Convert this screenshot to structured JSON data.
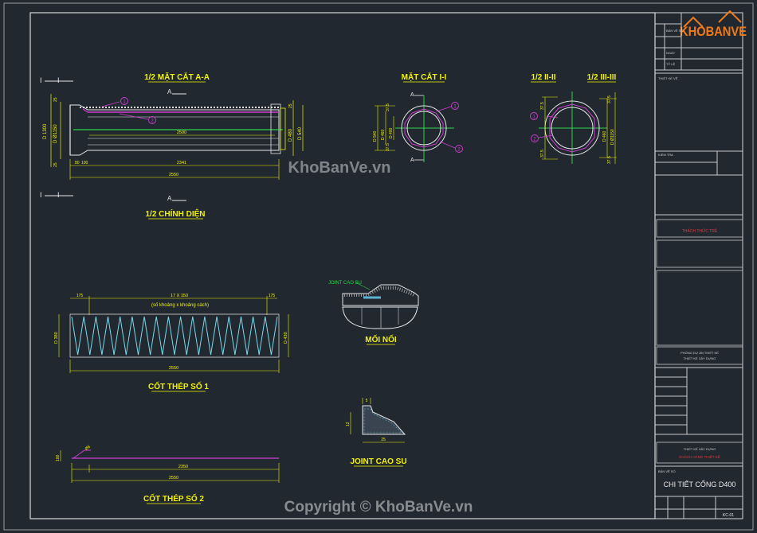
{
  "drawing": {
    "views": {
      "section_aa_title": "1/2 MẶT CẮT A-A",
      "front_view_title": "1/2 CHÍNH DIỆN",
      "section_ii_title": "MẶT CẮT I-I",
      "half_ii_title": "1/2 II-II",
      "half_iii_title": "1/2 III-III",
      "joint_title": "MỐI NỐI",
      "rebar1_title": "CỐT THÉP SỐ 1",
      "rebar2_title": "CỐT THÉP SỐ 2",
      "rubber_joint_title": "JOINT CAO SU"
    },
    "section_markers": {
      "I": "I",
      "A": "A",
      "II": "II",
      "III": "III"
    },
    "dims": {
      "aa_inner": "2500",
      "aa_inner_lower": "2341",
      "aa_total": "2550",
      "aa_left_dia": "D 1300",
      "aa_left_dia2": "D Ø1150",
      "aa_right_dia1": "D 480",
      "aa_right_dia2": "D 540",
      "aa_small1": "25",
      "aa_small2": "80",
      "aa_small3": "100",
      "aa_small4": "25",
      "ii_dia1": "D 540",
      "ii_dia2": "D 460",
      "ii_dia3": "D 400",
      "ii_thk": "37.5",
      "iii_dia1": "D 460",
      "iii_dia2": "D Ø1150",
      "iii_thk": "37.5",
      "rebar1_top": "17 X 150",
      "rebar1_note": "(số khoảng x khoảng cách)",
      "rebar1_left": "175",
      "rebar1_right": "175",
      "rebar1_dia_left": "D 380",
      "rebar1_dia_right": "D 430",
      "rebar1_total": "2550",
      "rebar2_len": "2350",
      "rebar2_total": "2550",
      "rebar2_end": "100",
      "rebar2_hook": "Ø6",
      "rubber_w": "25",
      "rubber_h": "12",
      "rubber_t": "5",
      "joint_label": "JOINT CAO SU"
    },
    "callouts": [
      "1",
      "2"
    ]
  },
  "title_block": {
    "logo_text": "KHOBANVE",
    "rows_small": [
      "BẢN VẼ SỐ",
      "NGÀY",
      "TỶ LỆ"
    ],
    "designer_label": "THIẾT KẾ VẼ",
    "checker_label": "KIỂM TRA",
    "red_text": "THÁCH THỨC TRẺ",
    "project_line1": "PHÒNG DỰ ÁN THIẾT KẾ",
    "project_line2": "THIẾT KẾ XÂY DỰNG",
    "sheet_title": "CHI TIẾT CỐNG D400",
    "sheet_no_label": "BẢN VẼ SỐ",
    "footer_code": "KC-01",
    "red_text2": "KHÁCH HÀNG THIẾT KẾ"
  },
  "watermarks": {
    "center": "KhoBanVe.vn",
    "copyright": "Copyright © KhoBanVe.vn"
  },
  "colors": {
    "background": "#212830",
    "dimension": "#f2f200",
    "outline": "#e8e8e8",
    "rebar": "#7ad8e8",
    "callout": "#d040d0",
    "centerline": "#2fd24a",
    "hatch": "#5ab4d0",
    "accent_red": "#e23a3a",
    "logo_orange": "#f07a1a"
  }
}
